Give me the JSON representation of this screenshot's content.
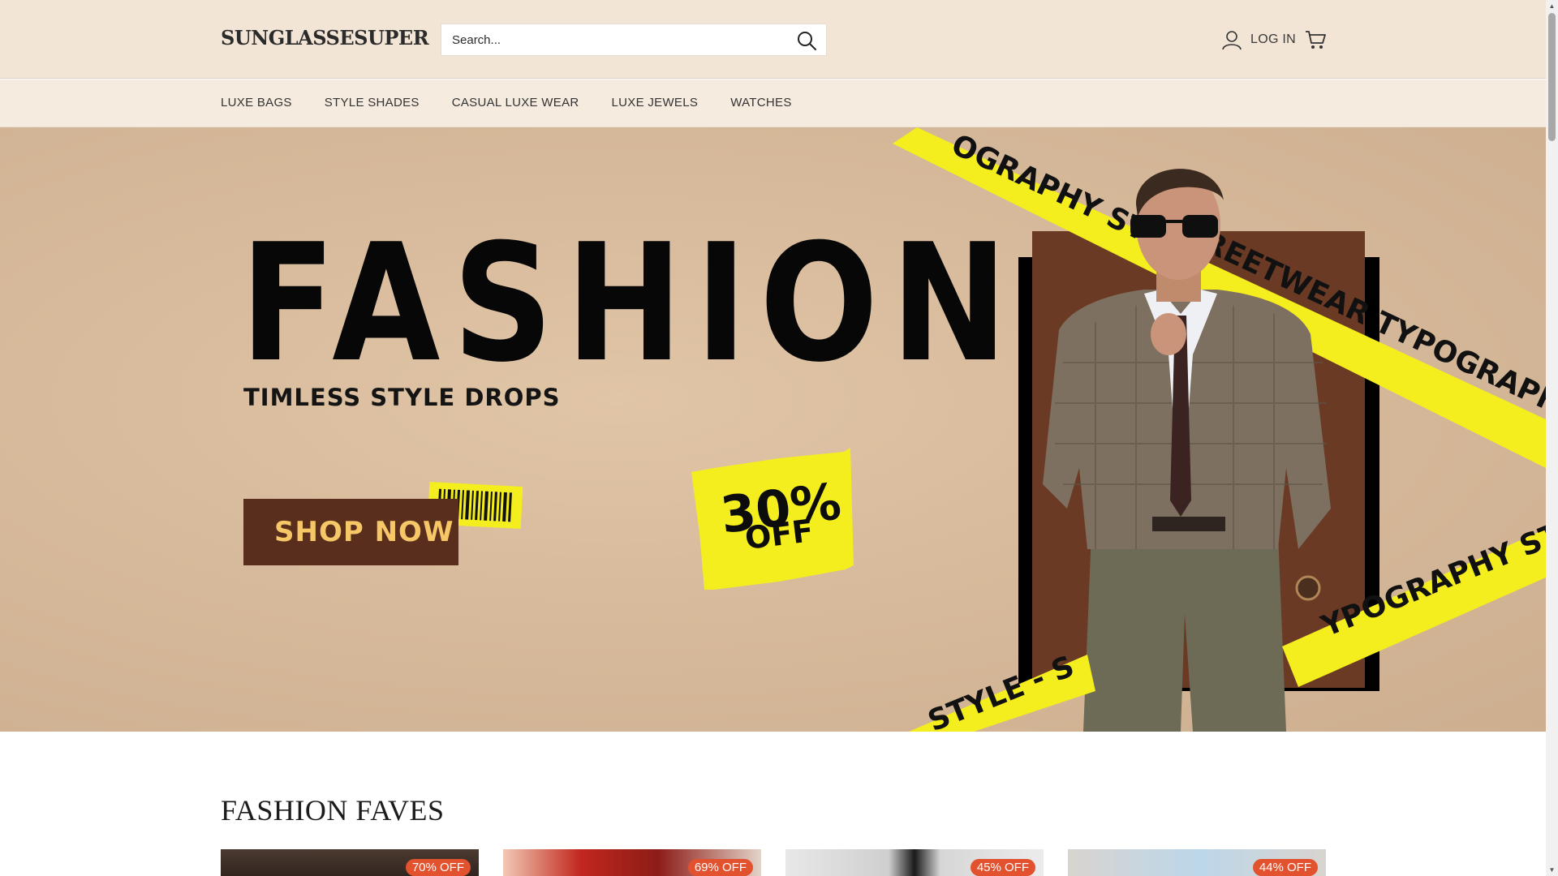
{
  "header": {
    "logo": "SUNGLASSESUPER",
    "search_placeholder": "Search...",
    "search_icon": "search-icon",
    "login_label": "LOG IN",
    "account_icon": "user-icon",
    "cart_icon": "cart-icon"
  },
  "nav": {
    "items": [
      {
        "label": "LUXE BAGS"
      },
      {
        "label": "STYLE SHADES"
      },
      {
        "label": "CASUAL LUXE WEAR"
      },
      {
        "label": "LUXE JEWELS"
      },
      {
        "label": "WATCHES"
      }
    ]
  },
  "hero": {
    "headline": "FASHION",
    "tagline": "TIMLESS STYLE DROPS",
    "cta_label": "SHOP NOW",
    "offer_percent": "30%",
    "offer_word": "OFF",
    "tape_text_1": "OGRAPHY ST",
    "tape_text_2": "REETWEAR TYPOGRAPHY ST",
    "tape_text_3": "YPOGRAPHY ST",
    "tape_text_4": "STYLE - S"
  },
  "section": {
    "title": "FASHION FAVES",
    "products": [
      {
        "badge": "70% OFF"
      },
      {
        "badge": "69% OFF"
      },
      {
        "badge": "45% OFF"
      },
      {
        "badge": "44% OFF"
      }
    ]
  },
  "colors": {
    "header_bg": "#f3e5d5",
    "nav_bg": "#f6ebdf",
    "cta_bg": "#5a2e1c",
    "cta_text": "#f6c766",
    "tape_yellow": "#f4ee1e",
    "badge": "#e2522f"
  }
}
